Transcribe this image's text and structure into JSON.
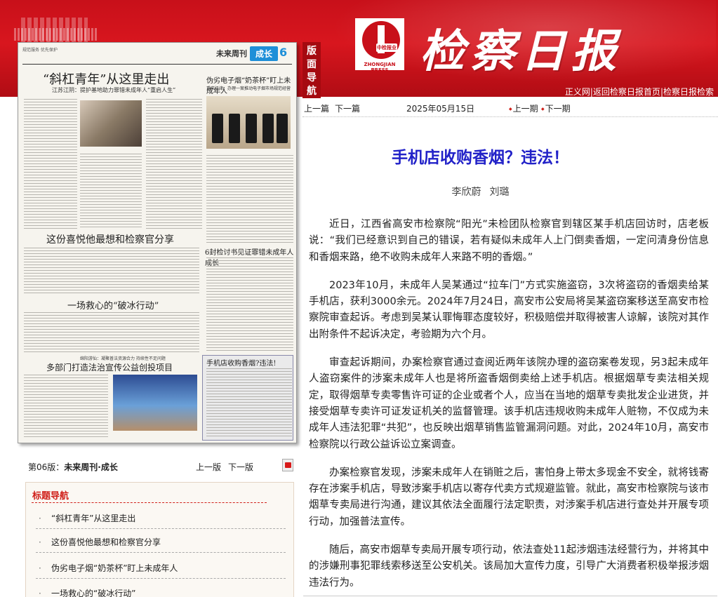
{
  "header": {
    "masthead": "检察日报",
    "logo_mark": "中检报业",
    "logo_press": "ZHONGJIAN PRESS",
    "nav_tab": "版面导航",
    "links": [
      "正义网",
      "返回检察日报首页",
      "检察日报检索"
    ]
  },
  "paper_page": {
    "left_header": "规范服务 优先保护",
    "section_name": "未来周刊",
    "section_badge": "成长",
    "page_number": "6",
    "headlines": [
      "“斜杠青年”从这里走出",
      "江苏江阴：提护基地助力罪错未成年人“重启人生”",
      "伪劣电子烟“奶茶杯”盯上未成年人",
      "重庆江津：办理一案推动电子烟市场规范经营",
      "这份喜悦他最想和检察官分享",
      "6封检讨书见证罪错未成年人成长",
      "一场救心的“破冰行动”",
      "绵阳游仙：凝聚普法资源合力 持续性不足问题",
      "多部门打造法治宣传公益创投项目",
      "手机店收购香烟?违法!"
    ]
  },
  "edition": {
    "label": "第06版：",
    "name": "未来周刊·成长",
    "prev": "上一版",
    "next": "下一版"
  },
  "headline_nav": {
    "title": "标题导航",
    "items": [
      "“斜杠青年”从这里走出",
      "这份喜悦他最想和检察官分享",
      "伪劣电子烟“奶茶杯”盯上未成年人",
      "一场救心的“破冰行动”"
    ]
  },
  "article_nav": {
    "prev_article": "上一篇",
    "next_article": "下一篇",
    "date": "2025年05月15日",
    "prev_issue": "上一期",
    "next_issue": "下一期"
  },
  "article": {
    "title": "手机店收购香烟？违法！",
    "authors": [
      "李欣蔚",
      "刘璐"
    ],
    "paragraphs": [
      "近日，江西省高安市检察院“阳光”未检团队检察官到辖区某手机店回访时，店老板说：“我们已经意识到自己的错误，若有疑似未成年人上门倒卖香烟，一定问清身份信息和香烟来路，绝不收购未成年人来路不明的香烟。”",
      "2023年10月，未成年人吴某通过“拉车门”方式实施盗窃，3次将盗窃的香烟卖给某手机店，获利3000余元。2024年7月24日，高安市公安局将吴某盗窃案移送至高安市检察院审查起诉。考虑到吴某认罪悔罪态度较好，积极赔偿并取得被害人谅解，该院对其作出附条件不起诉决定，考验期为六个月。",
      "审查起诉期间，办案检察官通过查阅近两年该院办理的盗窃案卷发现，另3起未成年人盗窃案件的涉案未成年人也是将所盗香烟倒卖给上述手机店。根据烟草专卖法相关规定，取得烟草专卖零售许可证的企业或者个人，应当在当地的烟草专卖批发企业进货，并接受烟草专卖许可证发证机关的监督管理。该手机店违规收购未成年人赃物，不仅成为未成年人违法犯罪“共犯”，也反映出烟草销售监管漏洞问题。对此，2024年10月，高安市检察院以行政公益诉讼立案调查。",
      "办案检察官发现，涉案未成年人在销赃之后，害怕身上带太多现金不安全，就将钱寄存在涉案手机店，导致涉案手机店以寄存代卖方式规避监管。就此，高安市检察院与该市烟草专卖局进行沟通，建议其依法全面履行法定职责，对涉案手机店进行查处并开展专项行动，加强普法宣传。",
      "随后，高安市烟草专卖局开展专项行动，依法查处11起涉烟违法经营行为，并将其中的涉嫌刑事犯罪线索移送至公安机关。该局加大宣传力度，引导广大消费者积极举报涉烟违法行为。"
    ]
  },
  "colors": {
    "banner_red": "#c8101a",
    "title_blue": "#2222c8",
    "nav_red": "#d0201a",
    "badge_blue": "#1e8fd8"
  }
}
